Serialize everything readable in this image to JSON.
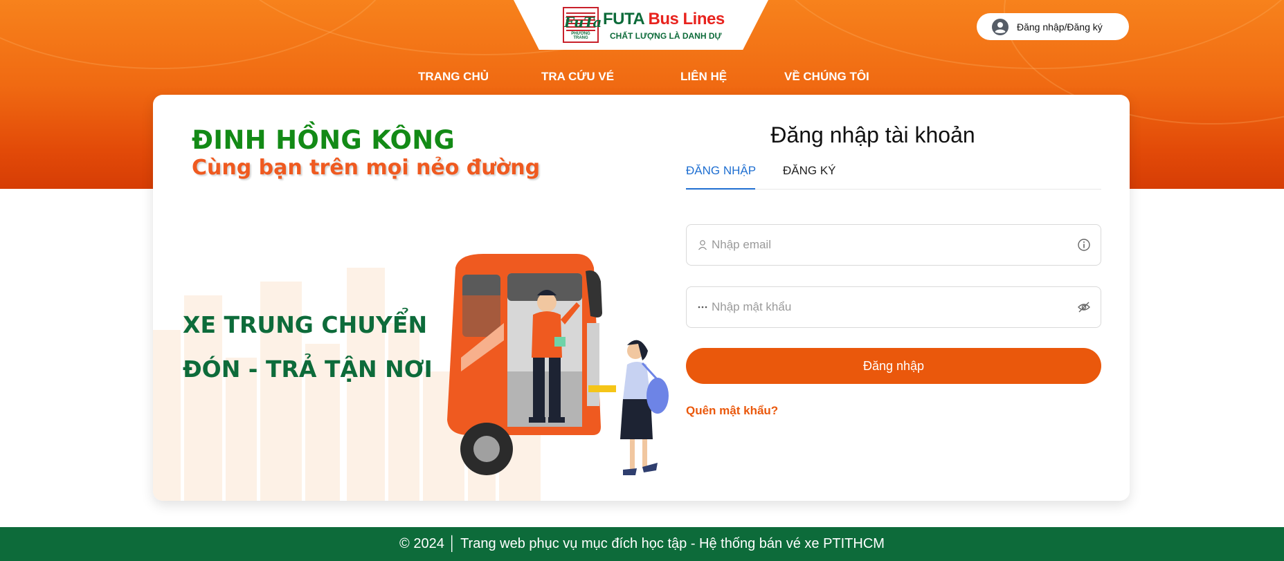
{
  "header": {
    "logo": {
      "brand_futa": "FUTA",
      "brand_bus": "Bus Lines",
      "slogan": "CHẤT LƯỢNG LÀ DANH DỰ",
      "mark_text": "FuTa",
      "mark_sub": "PHƯƠNG TRANG"
    },
    "login_button": "Đăng nhập/Đăng ký",
    "nav": [
      "TRANG CHỦ",
      "TRA CỨU VÉ",
      "LIÊN HỆ",
      "VỀ CHÚNG TÔI"
    ]
  },
  "promo": {
    "title": "ĐINH HỒNG KÔNG",
    "subtitle": "Cùng bạn trên mọi nẻo đường",
    "line1": "XE TRUNG CHUYỂN",
    "line2": "ĐÓN - TRẢ TẬN NƠI"
  },
  "form": {
    "title": "Đăng nhập tài khoản",
    "tabs": [
      {
        "label": "ĐĂNG NHẬP",
        "active": true
      },
      {
        "label": "ĐĂNG KÝ",
        "active": false
      }
    ],
    "email_placeholder": "Nhập email",
    "password_placeholder": "Nhập mật khẩu",
    "submit": "Đăng nhập",
    "forgot": "Quên mật khẩu?"
  },
  "footer": {
    "text": "© 2024 │ Trang web phục vụ mục đích học tập - Hệ thống bán vé xe PTITHCM"
  },
  "colors": {
    "accent": "#ea580c",
    "brand_green": "#0d6b3a",
    "tab_active": "#1f6fd1",
    "hero_orange": "#f06a12"
  }
}
